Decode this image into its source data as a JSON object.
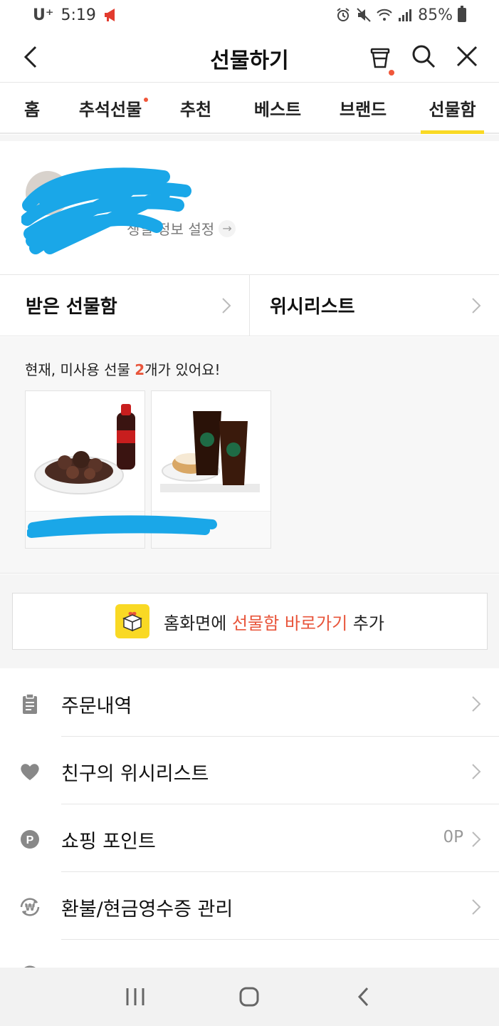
{
  "status_bar": {
    "carrier": "U⁺",
    "time": "5:19",
    "battery": "85%"
  },
  "header": {
    "title": "선물하기"
  },
  "tabs": [
    {
      "label": "홈"
    },
    {
      "label": "추석선물",
      "dot": true
    },
    {
      "label": "추천"
    },
    {
      "label": "베스트"
    },
    {
      "label": "브랜드"
    },
    {
      "label": "선물함",
      "active": true
    }
  ],
  "profile": {
    "birthday_link": "생일 정보 설정"
  },
  "split_row": {
    "received": "받은 선물함",
    "wishlist": "위시리스트"
  },
  "unused": {
    "prefix": "현재, 미사용 선물 ",
    "count": "2",
    "suffix": "개가 있어요!"
  },
  "banner": {
    "prefix": "홈화면에 ",
    "highlight": "선물함 바로가기",
    "suffix": " 추가"
  },
  "menu": [
    {
      "label": "주문내역",
      "icon": "clipboard-icon"
    },
    {
      "label": "친구의 위시리스트",
      "icon": "heart-icon"
    },
    {
      "label": "쇼핑 포인트",
      "icon": "point-icon",
      "value": "0P"
    },
    {
      "label": "환불/현금영수증 관리",
      "icon": "refund-icon"
    },
    {
      "label": "",
      "icon": "coupon-icon"
    }
  ],
  "colors": {
    "accent_yellow": "#f9d924",
    "accent_red": "#e8553b",
    "redaction_blue": "#1aa7e8"
  }
}
